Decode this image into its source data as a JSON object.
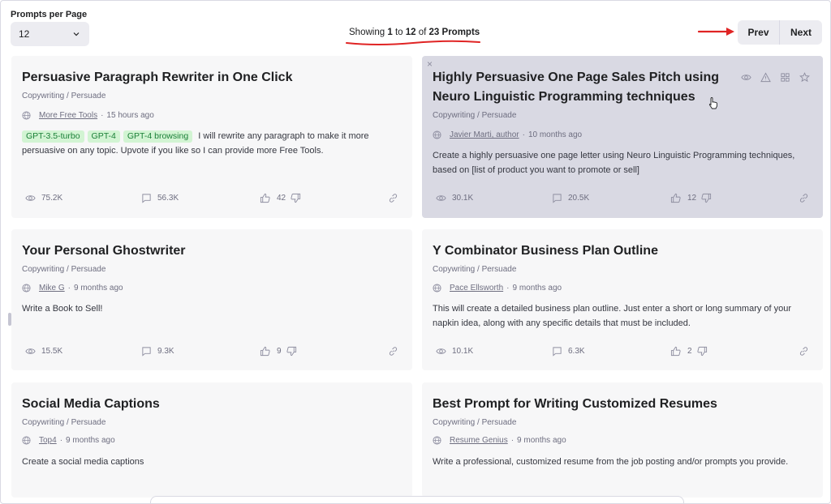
{
  "per_page": {
    "label": "Prompts per Page",
    "value": "12"
  },
  "showing": {
    "prefix": "Showing",
    "from": "1",
    "to_word": "to",
    "to": "12",
    "of_word": "of",
    "total": "23 Prompts"
  },
  "pager": {
    "prev": "Prev",
    "next": "Next"
  },
  "colors": {
    "card_bg": "#f7f7f8",
    "hover_card_bg": "#d9d9e3",
    "tag_bg": "#d2f4d3",
    "tag_text": "#1a7f37",
    "annotation_red": "#e02424"
  },
  "cards": [
    {
      "title": "Persuasive Paragraph Rewriter in One Click",
      "category": "Copywriting / Persuade",
      "author": "More Free Tools",
      "time": "15 hours ago",
      "tags": [
        "GPT-3.5-turbo",
        "GPT-4",
        "GPT-4 browsing"
      ],
      "description": "I will rewrite any paragraph to make it more persuasive on any topic. Upvote if you like so I can provide more Free Tools.",
      "views": "75.2K",
      "comments": "56.3K",
      "likes": "42"
    },
    {
      "title": "Highly Persuasive One Page Sales Pitch using Neuro Linguistic Programming techniques",
      "category": "Copywriting / Persuade",
      "author": "Javier Marti, author",
      "time": "10 months ago",
      "description": "Create a highly persuasive one page letter using Neuro Linguistic Programming techniques, based on [list of product you want to promote or sell]",
      "views": "30.1K",
      "comments": "20.5K",
      "likes": "12",
      "close": "×"
    },
    {
      "title": "Your Personal Ghostwriter",
      "category": "Copywriting / Persuade",
      "author": "Mike G",
      "time": "9 months ago",
      "description": "Write a Book to Sell!",
      "views": "15.5K",
      "comments": "9.3K",
      "likes": "9"
    },
    {
      "title": "Y Combinator Business Plan Outline",
      "category": "Copywriting / Persuade",
      "author": "Pace Ellsworth",
      "time": "9 months ago",
      "description": "This will create a detailed business plan outline. Just enter a short or long summary of your napkin idea, along with any specific details that must be included.",
      "views": "10.1K",
      "comments": "6.3K",
      "likes": "2"
    },
    {
      "title": "Social Media Captions",
      "category": "Copywriting / Persuade",
      "author": "Top4",
      "time": "9 months ago",
      "description": "Create a social media captions"
    },
    {
      "title": "Best Prompt for Writing Customized Resumes",
      "category": "Copywriting / Persuade",
      "author": "Resume Genius",
      "time": "9 months ago",
      "description": "Write a professional, customized resume from the job posting and/or prompts you provide."
    }
  ]
}
